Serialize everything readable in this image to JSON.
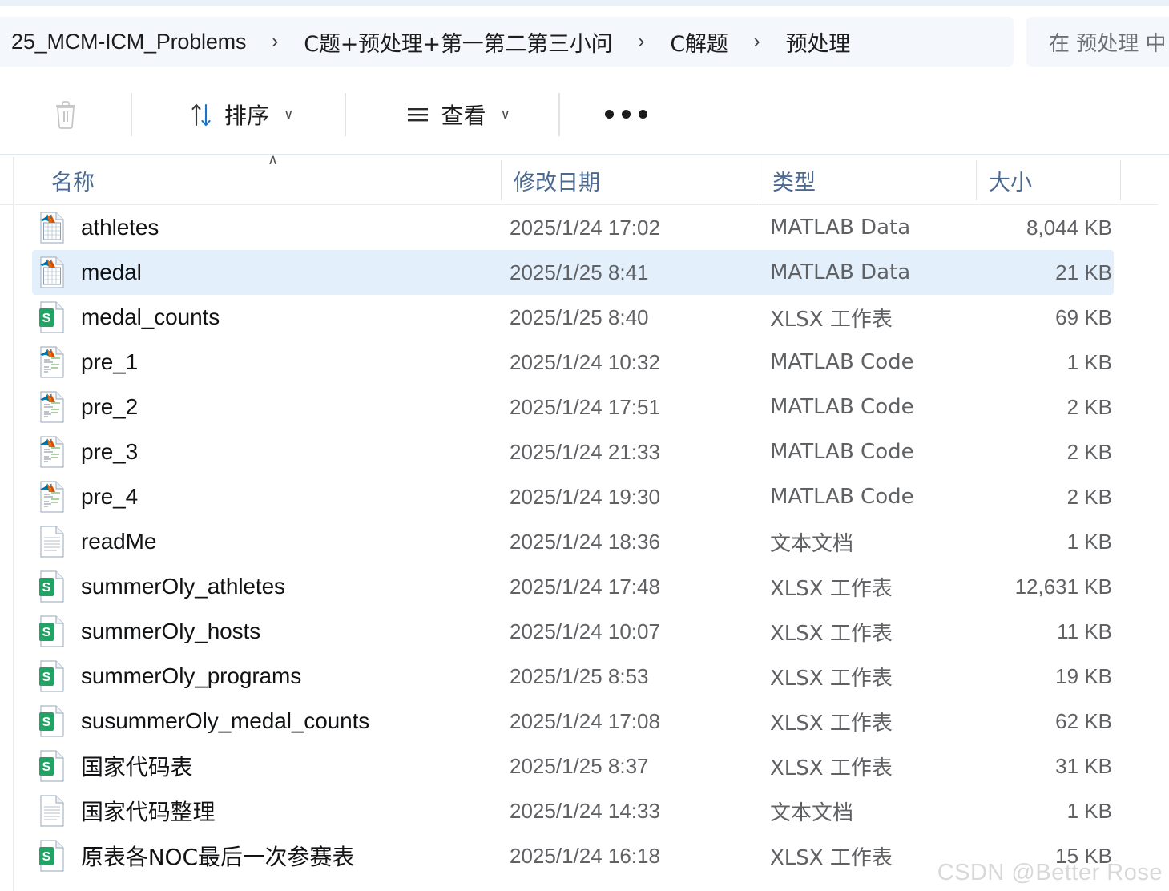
{
  "breadcrumb": {
    "items": [
      {
        "label": "25_MCM-ICM_Problems"
      },
      {
        "label": "C题+预处理+第一第二第三小问"
      },
      {
        "label": "C解题"
      },
      {
        "label": "预处理"
      }
    ],
    "separator": "›"
  },
  "search": {
    "placeholder": "在 预处理 中"
  },
  "toolbar": {
    "delete_label": "",
    "sort_label": "排序",
    "view_label": "查看",
    "more_label": "•••",
    "chevron": "∨"
  },
  "columns": {
    "name": "名称",
    "date_modified": "修改日期",
    "type": "类型",
    "size": "大小",
    "sort_caret": "∧"
  },
  "colors": {
    "selection": "#e3f0fb",
    "header_text": "#4b6a92",
    "excel_green": "#21a366",
    "matlab_orange": "#e8690b",
    "matlab_blue": "#0076a8",
    "addressbar_bg": "#f4f7fb",
    "watermark": "#d8d8d8"
  },
  "files": [
    {
      "name": "athletes",
      "icon": "matlab-data-icon",
      "date": "2025/1/24 17:02",
      "type": "MATLAB Data",
      "size": "8,044 KB",
      "selected": false,
      "zh": false
    },
    {
      "name": "medal",
      "icon": "matlab-data-icon",
      "date": "2025/1/25 8:41",
      "type": "MATLAB Data",
      "size": "21 KB",
      "selected": true,
      "zh": false
    },
    {
      "name": "medal_counts",
      "icon": "excel-icon",
      "date": "2025/1/25 8:40",
      "type": "XLSX 工作表",
      "size": "69 KB",
      "selected": false,
      "zh": false
    },
    {
      "name": "pre_1",
      "icon": "matlab-code-icon",
      "date": "2025/1/24 10:32",
      "type": "MATLAB Code",
      "size": "1 KB",
      "selected": false,
      "zh": false
    },
    {
      "name": "pre_2",
      "icon": "matlab-code-icon",
      "date": "2025/1/24 17:51",
      "type": "MATLAB Code",
      "size": "2 KB",
      "selected": false,
      "zh": false
    },
    {
      "name": "pre_3",
      "icon": "matlab-code-icon",
      "date": "2025/1/24 21:33",
      "type": "MATLAB Code",
      "size": "2 KB",
      "selected": false,
      "zh": false
    },
    {
      "name": "pre_4",
      "icon": "matlab-code-icon",
      "date": "2025/1/24 19:30",
      "type": "MATLAB Code",
      "size": "2 KB",
      "selected": false,
      "zh": false
    },
    {
      "name": "readMe",
      "icon": "text-file-icon",
      "date": "2025/1/24 18:36",
      "type": "文本文档",
      "size": "1 KB",
      "selected": false,
      "zh": false
    },
    {
      "name": "summerOly_athletes",
      "icon": "excel-icon",
      "date": "2025/1/24 17:48",
      "type": "XLSX 工作表",
      "size": "12,631 KB",
      "selected": false,
      "zh": false
    },
    {
      "name": "summerOly_hosts",
      "icon": "excel-icon",
      "date": "2025/1/24 10:07",
      "type": "XLSX 工作表",
      "size": "11 KB",
      "selected": false,
      "zh": false
    },
    {
      "name": "summerOly_programs",
      "icon": "excel-icon",
      "date": "2025/1/25 8:53",
      "type": "XLSX 工作表",
      "size": "19 KB",
      "selected": false,
      "zh": false
    },
    {
      "name": "susummerOly_medal_counts",
      "icon": "excel-icon",
      "date": "2025/1/24 17:08",
      "type": "XLSX 工作表",
      "size": "62 KB",
      "selected": false,
      "zh": false
    },
    {
      "name": "国家代码表",
      "icon": "excel-icon",
      "date": "2025/1/25 8:37",
      "type": "XLSX 工作表",
      "size": "31 KB",
      "selected": false,
      "zh": true
    },
    {
      "name": "国家代码整理",
      "icon": "text-file-icon",
      "date": "2025/1/24 14:33",
      "type": "文本文档",
      "size": "1 KB",
      "selected": false,
      "zh": true
    },
    {
      "name": "原表各NOC最后一次参赛表",
      "icon": "excel-icon",
      "date": "2025/1/24 16:18",
      "type": "XLSX 工作表",
      "size": "15 KB",
      "selected": false,
      "zh": true
    }
  ],
  "watermark": "CSDN @Better Rose"
}
